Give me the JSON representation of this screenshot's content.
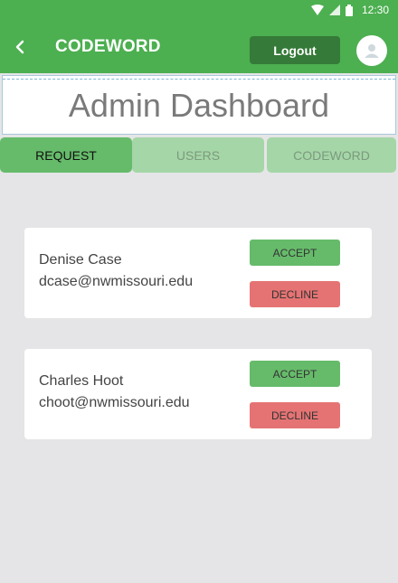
{
  "status_bar": {
    "time": "12:30",
    "icons": [
      "wifi-icon",
      "signal-icon",
      "battery-icon"
    ]
  },
  "app_bar": {
    "back_icon": "chevron-left-icon",
    "title": "CODEWORD",
    "logout_label": "Logout",
    "avatar_icon": "account-icon"
  },
  "page": {
    "heading": "Admin Dashboard"
  },
  "tabs": [
    {
      "label": "REQUEST",
      "active": true
    },
    {
      "label": "USERS",
      "active": false
    },
    {
      "label": "CODEWORD",
      "active": false
    }
  ],
  "requests": [
    {
      "name": "Denise Case",
      "email": "dcase@nwmissouri.edu",
      "accept_label": "ACCEPT",
      "decline_label": "DECLINE"
    },
    {
      "name": "Charles Hoot",
      "email": "choot@nwmissouri.edu",
      "accept_label": "ACCEPT",
      "decline_label": "DECLINE"
    }
  ],
  "colors": {
    "primary": "#4caf50",
    "primary_dark": "#357a38",
    "accept": "#66bb6a",
    "decline": "#e57373",
    "tab_inactive": "#a5d6a7",
    "background": "#e5e5e7"
  }
}
